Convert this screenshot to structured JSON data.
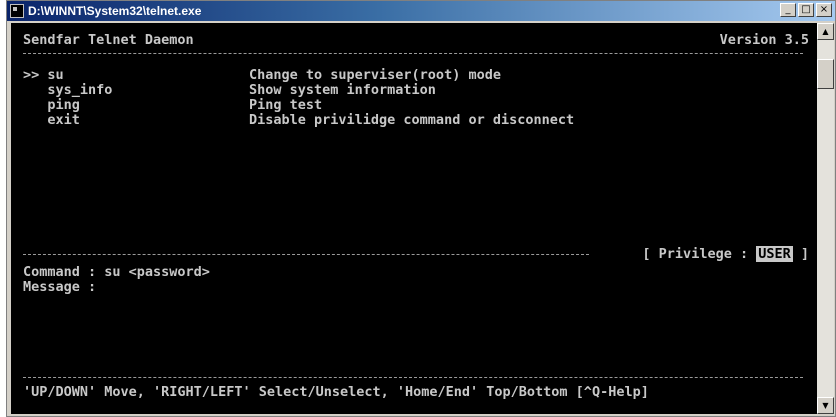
{
  "window": {
    "title": "D:\\WINNT\\System32\\telnet.exe",
    "minimize_glyph": "_",
    "maximize_glyph": "□",
    "close_glyph": "×"
  },
  "terminal": {
    "header_left": "Sendfar Telnet Daemon",
    "header_right": "Version 3.5",
    "menu": [
      {
        "prefix": ">> ",
        "name": "su",
        "desc": "Change to superviser(root) mode"
      },
      {
        "prefix": "   ",
        "name": "sys_info",
        "desc": "Show system information"
      },
      {
        "prefix": "   ",
        "name": "ping",
        "desc": "Ping test"
      },
      {
        "prefix": "   ",
        "name": "exit",
        "desc": "Disable privilidge command or disconnect"
      }
    ],
    "privilege_open": "[ Privilege : ",
    "privilege_value": "USER",
    "privilege_close": " ]",
    "command_line": "Command : su <password>",
    "message_line": "Message :",
    "footer": "'UP/DOWN' Move, 'RIGHT/LEFT' Select/Unselect, 'Home/End' Top/Bottom [^Q-Help]"
  },
  "scrollbar": {
    "up_glyph": "▲",
    "down_glyph": "▼"
  }
}
